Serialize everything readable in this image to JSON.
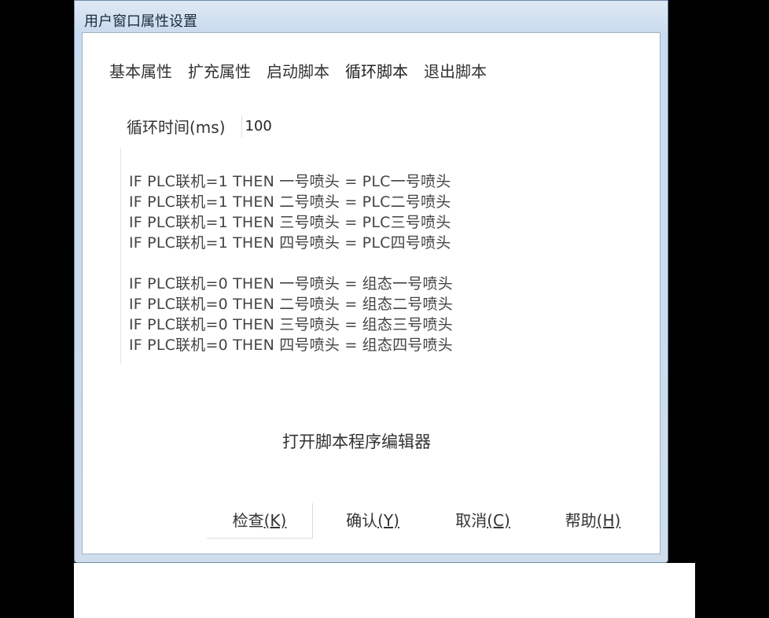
{
  "window": {
    "title": "用户窗口属性设置"
  },
  "tabs": [
    {
      "label": "基本属性"
    },
    {
      "label": "扩充属性"
    },
    {
      "label": "启动脚本"
    },
    {
      "label": "循环脚本"
    },
    {
      "label": "退出脚本"
    }
  ],
  "cycle": {
    "label": "循环时间(ms)",
    "value": "100"
  },
  "script": {
    "lines": [
      "IF PLC联机=1 THEN 一号喷头 = PLC一号喷头",
      "IF PLC联机=1 THEN 二号喷头 = PLC二号喷头",
      "IF PLC联机=1 THEN 三号喷头 = PLC三号喷头",
      "IF PLC联机=1 THEN 四号喷头 = PLC四号喷头",
      "",
      "IF PLC联机=0 THEN 一号喷头 = 组态一号喷头",
      "IF PLC联机=0 THEN 二号喷头 = 组态二号喷头",
      "IF PLC联机=0 THEN 三号喷头 = 组态三号喷头",
      "IF PLC联机=0 THEN 四号喷头 = 组态四号喷头"
    ]
  },
  "open_editor_label": "打开脚本程序编辑器",
  "buttons": {
    "check": {
      "text": "检查",
      "hotkey": "(K)"
    },
    "ok": {
      "text": "确认",
      "hotkey": "(Y)"
    },
    "cancel": {
      "text": "取消",
      "hotkey": "(C)"
    },
    "help": {
      "text": "帮助",
      "hotkey": "(H)"
    }
  }
}
